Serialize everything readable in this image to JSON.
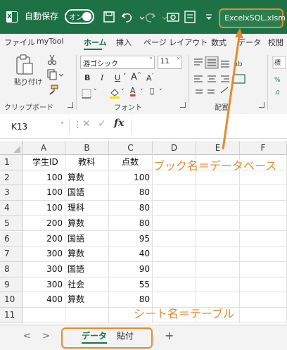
{
  "title_bar": {
    "autosave_label": "自動保存",
    "autosave_state": "オン",
    "file_name": "ExcelxSQL.xlsm"
  },
  "ribbon": {
    "tabs": [
      "ファイル",
      "myTool",
      "ホーム",
      "挿入",
      "ページ レイアウト",
      "数式",
      "データ",
      "校閲"
    ],
    "active_tab": "ホーム",
    "groups": [
      "クリップボード",
      "フォント",
      "配置"
    ],
    "paste_label": "貼り付け",
    "font_name": "游ゴシック",
    "font_size": "11"
  },
  "formula_bar": {
    "name_box": "K13",
    "fx": "fx",
    "formula": ""
  },
  "sheet": {
    "columns": [
      "A",
      "B",
      "C",
      "D",
      "E",
      "F"
    ],
    "row_numbers": [
      "1",
      "2",
      "3",
      "4",
      "5",
      "6",
      "7",
      "8",
      "9",
      "10",
      "11"
    ],
    "header_row": [
      "学生ID",
      "教科",
      "点数"
    ],
    "rows": [
      [
        "100",
        "算数",
        "100"
      ],
      [
        "100",
        "国語",
        "80"
      ],
      [
        "100",
        "理科",
        "80"
      ],
      [
        "200",
        "算数",
        "80"
      ],
      [
        "200",
        "国語",
        "95"
      ],
      [
        "300",
        "算数",
        "40"
      ],
      [
        "300",
        "国語",
        "90"
      ],
      [
        "300",
        "社会",
        "55"
      ],
      [
        "400",
        "算数",
        "80"
      ]
    ]
  },
  "sheet_tabs": {
    "tabs": [
      "データ",
      "貼付"
    ],
    "active": "データ",
    "add_label": "+"
  },
  "annotations": {
    "book_label": "ブック名＝データベース",
    "sheet_label": "シート名＝テーブル",
    "color": "#e88a2b"
  },
  "colors": {
    "excel_green": "#1e7145",
    "highlight_orange": "#e88a2b"
  }
}
